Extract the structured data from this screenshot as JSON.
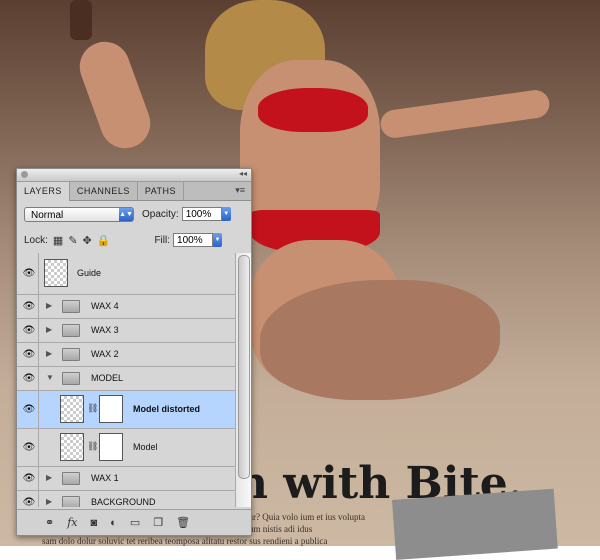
{
  "ad": {
    "headline": "n with Bite.",
    "body_lines": [
      "tur? Quia volo ium et ius volupta",
      "rerious misquo ulluntam dunti cum facequam, quiaestin eum nistis adi idus",
      "sam dolo dolur soluvic tet reribea teomposa alitatu restor sus rendieni a publica"
    ]
  },
  "panel": {
    "tabs": [
      "LAYERS",
      "CHANNELS",
      "PATHS"
    ],
    "blend_mode": "Normal",
    "opacity_label": "Opacity:",
    "opacity_value": "100%",
    "lock_label": "Lock:",
    "fill_label": "Fill:",
    "fill_value": "100%",
    "layers": [
      {
        "name": "Guide",
        "type": "layer"
      },
      {
        "name": "WAX 4",
        "type": "group"
      },
      {
        "name": "WAX 3",
        "type": "group"
      },
      {
        "name": "WAX 2",
        "type": "group"
      },
      {
        "name": "MODEL",
        "type": "group-open"
      },
      {
        "name": "Model distorted",
        "type": "layer-mask",
        "selected": true
      },
      {
        "name": "Model",
        "type": "layer-mask"
      },
      {
        "name": "WAX 1",
        "type": "group"
      },
      {
        "name": "BACKGROUND",
        "type": "group"
      }
    ],
    "footer_icons": [
      "link-icon",
      "fx-icon",
      "add-mask-icon",
      "adjustment-icon",
      "new-group-icon",
      "new-layer-icon",
      "trash-icon"
    ]
  },
  "colors": {
    "selected_row": "#b5d5ff",
    "bikini": "#c4121d"
  }
}
